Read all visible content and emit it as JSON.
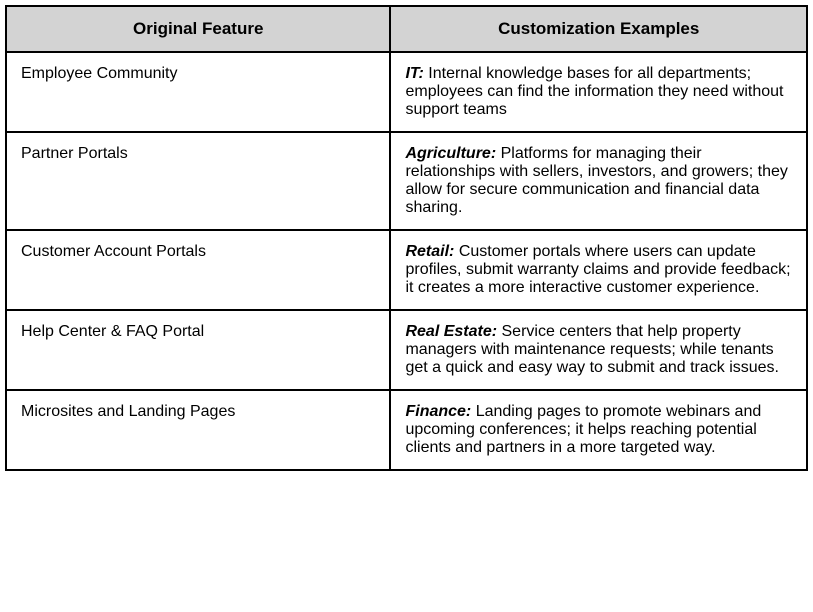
{
  "chart_data": {
    "type": "table",
    "headers": [
      "Original Feature",
      "Customization Examples"
    ],
    "rows": [
      {
        "feature": "Employee Community",
        "industry": "IT:",
        "description": " Internal knowledge bases for all departments; employees can find the information they need without support teams"
      },
      {
        "feature": "Partner Portals",
        "industry": "Agriculture:",
        "description": " Platforms for managing their relationships with sellers, investors, and growers; they allow for secure communication and financial data sharing."
      },
      {
        "feature": "Customer Account Portals",
        "industry": "Retail:",
        "description": " Customer portals where users can update profiles, submit warranty claims and provide feedback; it creates a more interactive customer experience."
      },
      {
        "feature": "Help Center & FAQ Portal",
        "industry": "Real Estate:",
        "description": " Service centers that help property managers with maintenance requests; while tenants get a quick and easy way to submit and track issues."
      },
      {
        "feature": "Microsites and Landing Pages",
        "industry": "Finance:",
        "description": " Landing pages to promote webinars and upcoming conferences; it helps reaching potential clients and partners in a more targeted way."
      }
    ]
  }
}
